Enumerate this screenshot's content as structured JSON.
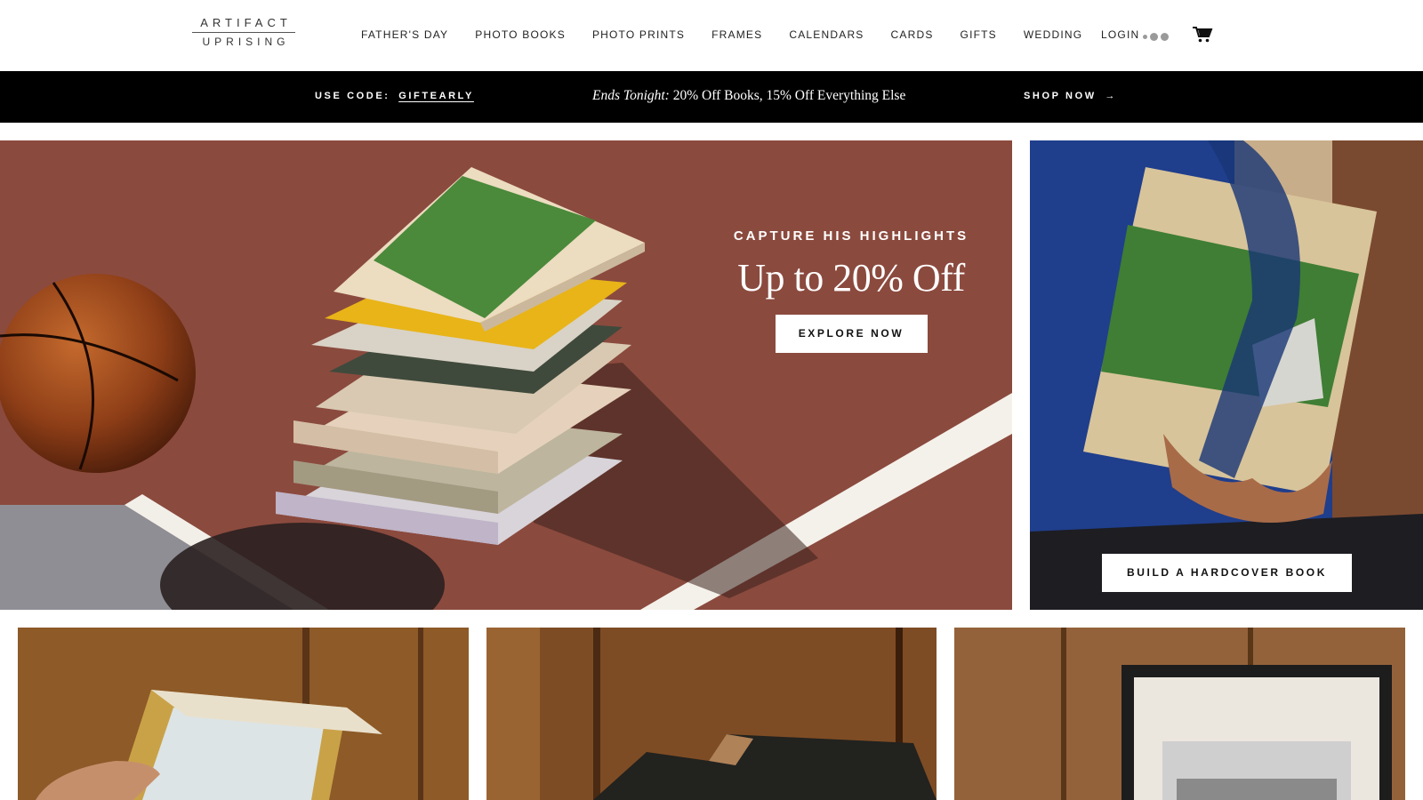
{
  "header": {
    "logo_line1": "ARTIFACT",
    "logo_line2": "UPRISING",
    "nav": [
      {
        "label": "FATHER'S DAY"
      },
      {
        "label": "PHOTO BOOKS"
      },
      {
        "label": "PHOTO PRINTS"
      },
      {
        "label": "FRAMES"
      },
      {
        "label": "CALENDARS"
      },
      {
        "label": "CARDS"
      },
      {
        "label": "GIFTS"
      },
      {
        "label": "WEDDING"
      }
    ],
    "login_label": "LOGIN",
    "cart_icon": "shopping-cart-icon"
  },
  "promo": {
    "code_prefix": "USE CODE:",
    "code": "GIFTEARLY",
    "message_em": "Ends Tonight:",
    "message": " 20% Off Books, 15% Off Everything Else",
    "shop_label": "SHOP NOW",
    "shop_arrow": "→"
  },
  "hero": {
    "eyebrow": "CAPTURE HIS HIGHLIGHTS",
    "title": "Up to 20% Off",
    "button_label": "EXPLORE NOW",
    "image_subject": "stack of photo books next to a basketball on a red court"
  },
  "side": {
    "button_label": "BUILD A HARDCOVER BOOK",
    "image_subject": "man in blue jacket holding a hardcover photo book"
  },
  "tiles": [
    {
      "image_subject": "hand holding a framed photo print"
    },
    {
      "image_subject": "dark photo book on wooden surface"
    },
    {
      "image_subject": "black frame with matted print"
    }
  ],
  "colors": {
    "promo_bg": "#000000",
    "court": "#8a4a3d",
    "jacket": "#1e3f8f",
    "wood": "#8a5a2a"
  }
}
